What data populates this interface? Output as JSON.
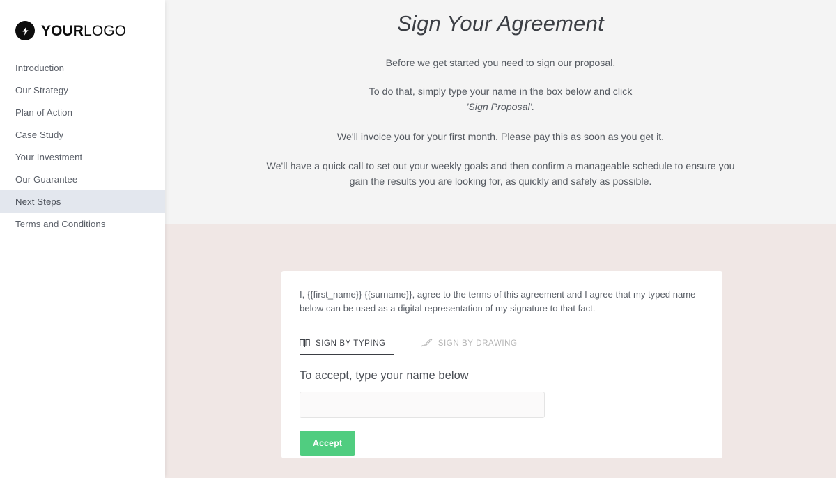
{
  "brand": {
    "logo_icon": "lightning-bolt-icon",
    "name_strong": "YOUR",
    "name_light": "LOGO"
  },
  "sidebar": {
    "items": [
      {
        "label": "Introduction",
        "active": false
      },
      {
        "label": "Our Strategy",
        "active": false
      },
      {
        "label": "Plan of Action",
        "active": false
      },
      {
        "label": "Case Study",
        "active": false
      },
      {
        "label": "Your Investment",
        "active": false
      },
      {
        "label": "Our Guarantee",
        "active": false
      },
      {
        "label": "Next Steps",
        "active": true
      },
      {
        "label": "Terms and Conditions",
        "active": false
      }
    ],
    "active_label": "Next Steps",
    "active_background": "#e3e7ee"
  },
  "main": {
    "title": "Sign Your Agreement",
    "paragraph_1": "Before we get started you need to sign our proposal.",
    "paragraph_2_line_1": "To do that, simply type your name in the box below and click",
    "paragraph_2_line_2": "'Sign Proposal'.",
    "paragraph_3": "We'll invoice you for your first month. Please pay this as soon as you get it.",
    "paragraph_4": "We'll have a quick call to set out your weekly goals and then confirm a manageable schedule to ensure you gain the results you are looking for, as quickly and safely as possible.",
    "background_top": "#f4f4f4",
    "background_bottom": "#f0e7e5"
  },
  "signature_card": {
    "consent_text": "I, {{first_name}} {{surname}}, agree to the terms of this agreement and I agree that my typed name below can be used as a digital representation of my signature to that fact.",
    "tabs": [
      {
        "label": "SIGN BY TYPING",
        "icon": "keyboard-typing-icon",
        "active": true
      },
      {
        "label": "SIGN BY DRAWING",
        "icon": "pen-drawing-icon",
        "active": false
      }
    ],
    "field_label": "To accept, type your name below",
    "input_value": "",
    "input_placeholder": "",
    "accept_label": "Accept",
    "accept_color": "#50cd80"
  }
}
